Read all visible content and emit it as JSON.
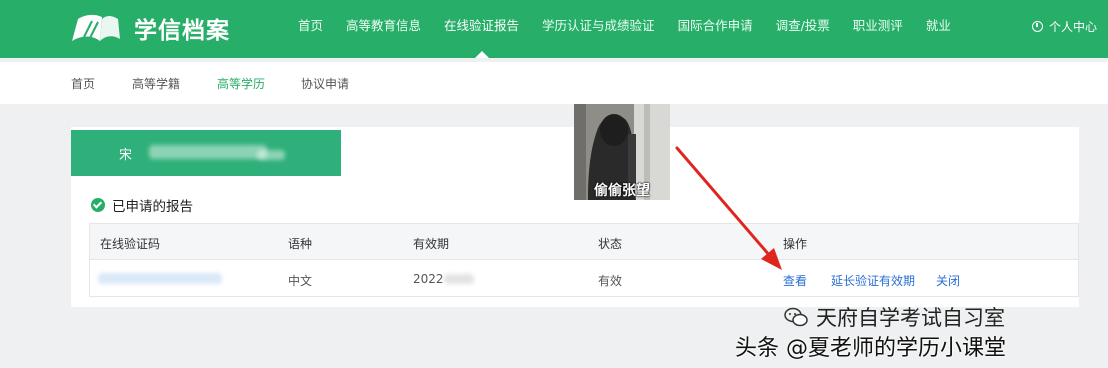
{
  "header": {
    "logo_text": "学信档案",
    "nav": [
      "首页",
      "高等教育信息",
      "在线验证报告",
      "学历认证与成绩验证",
      "国际合作申请",
      "调查/投票",
      "职业测评",
      "就业"
    ],
    "active_nav_index": 2,
    "user_label": "个人中心"
  },
  "subnav": {
    "items": [
      "首页",
      "高等学籍",
      "高等学历",
      "协议申请"
    ],
    "active_index": 2
  },
  "banner": {
    "name_initial": "宋"
  },
  "section": {
    "title": "已申请的报告"
  },
  "table": {
    "headers": [
      "在线验证码",
      "语种",
      "有效期",
      "状态",
      "操作"
    ],
    "row": {
      "language": "中文",
      "expiry": "2022",
      "status": "有效",
      "actions": [
        "查看",
        "延长验证有效期",
        "关闭"
      ]
    }
  },
  "sticker": {
    "caption": "偷偷张望"
  },
  "watermarks": {
    "line1": "天府自学考试自习室",
    "line2": "头条 @夏老师的学历小课堂"
  },
  "colors": {
    "brand_green": "#27ae68",
    "link_blue": "#2a6fd6",
    "arrow_red": "#e0251f"
  }
}
